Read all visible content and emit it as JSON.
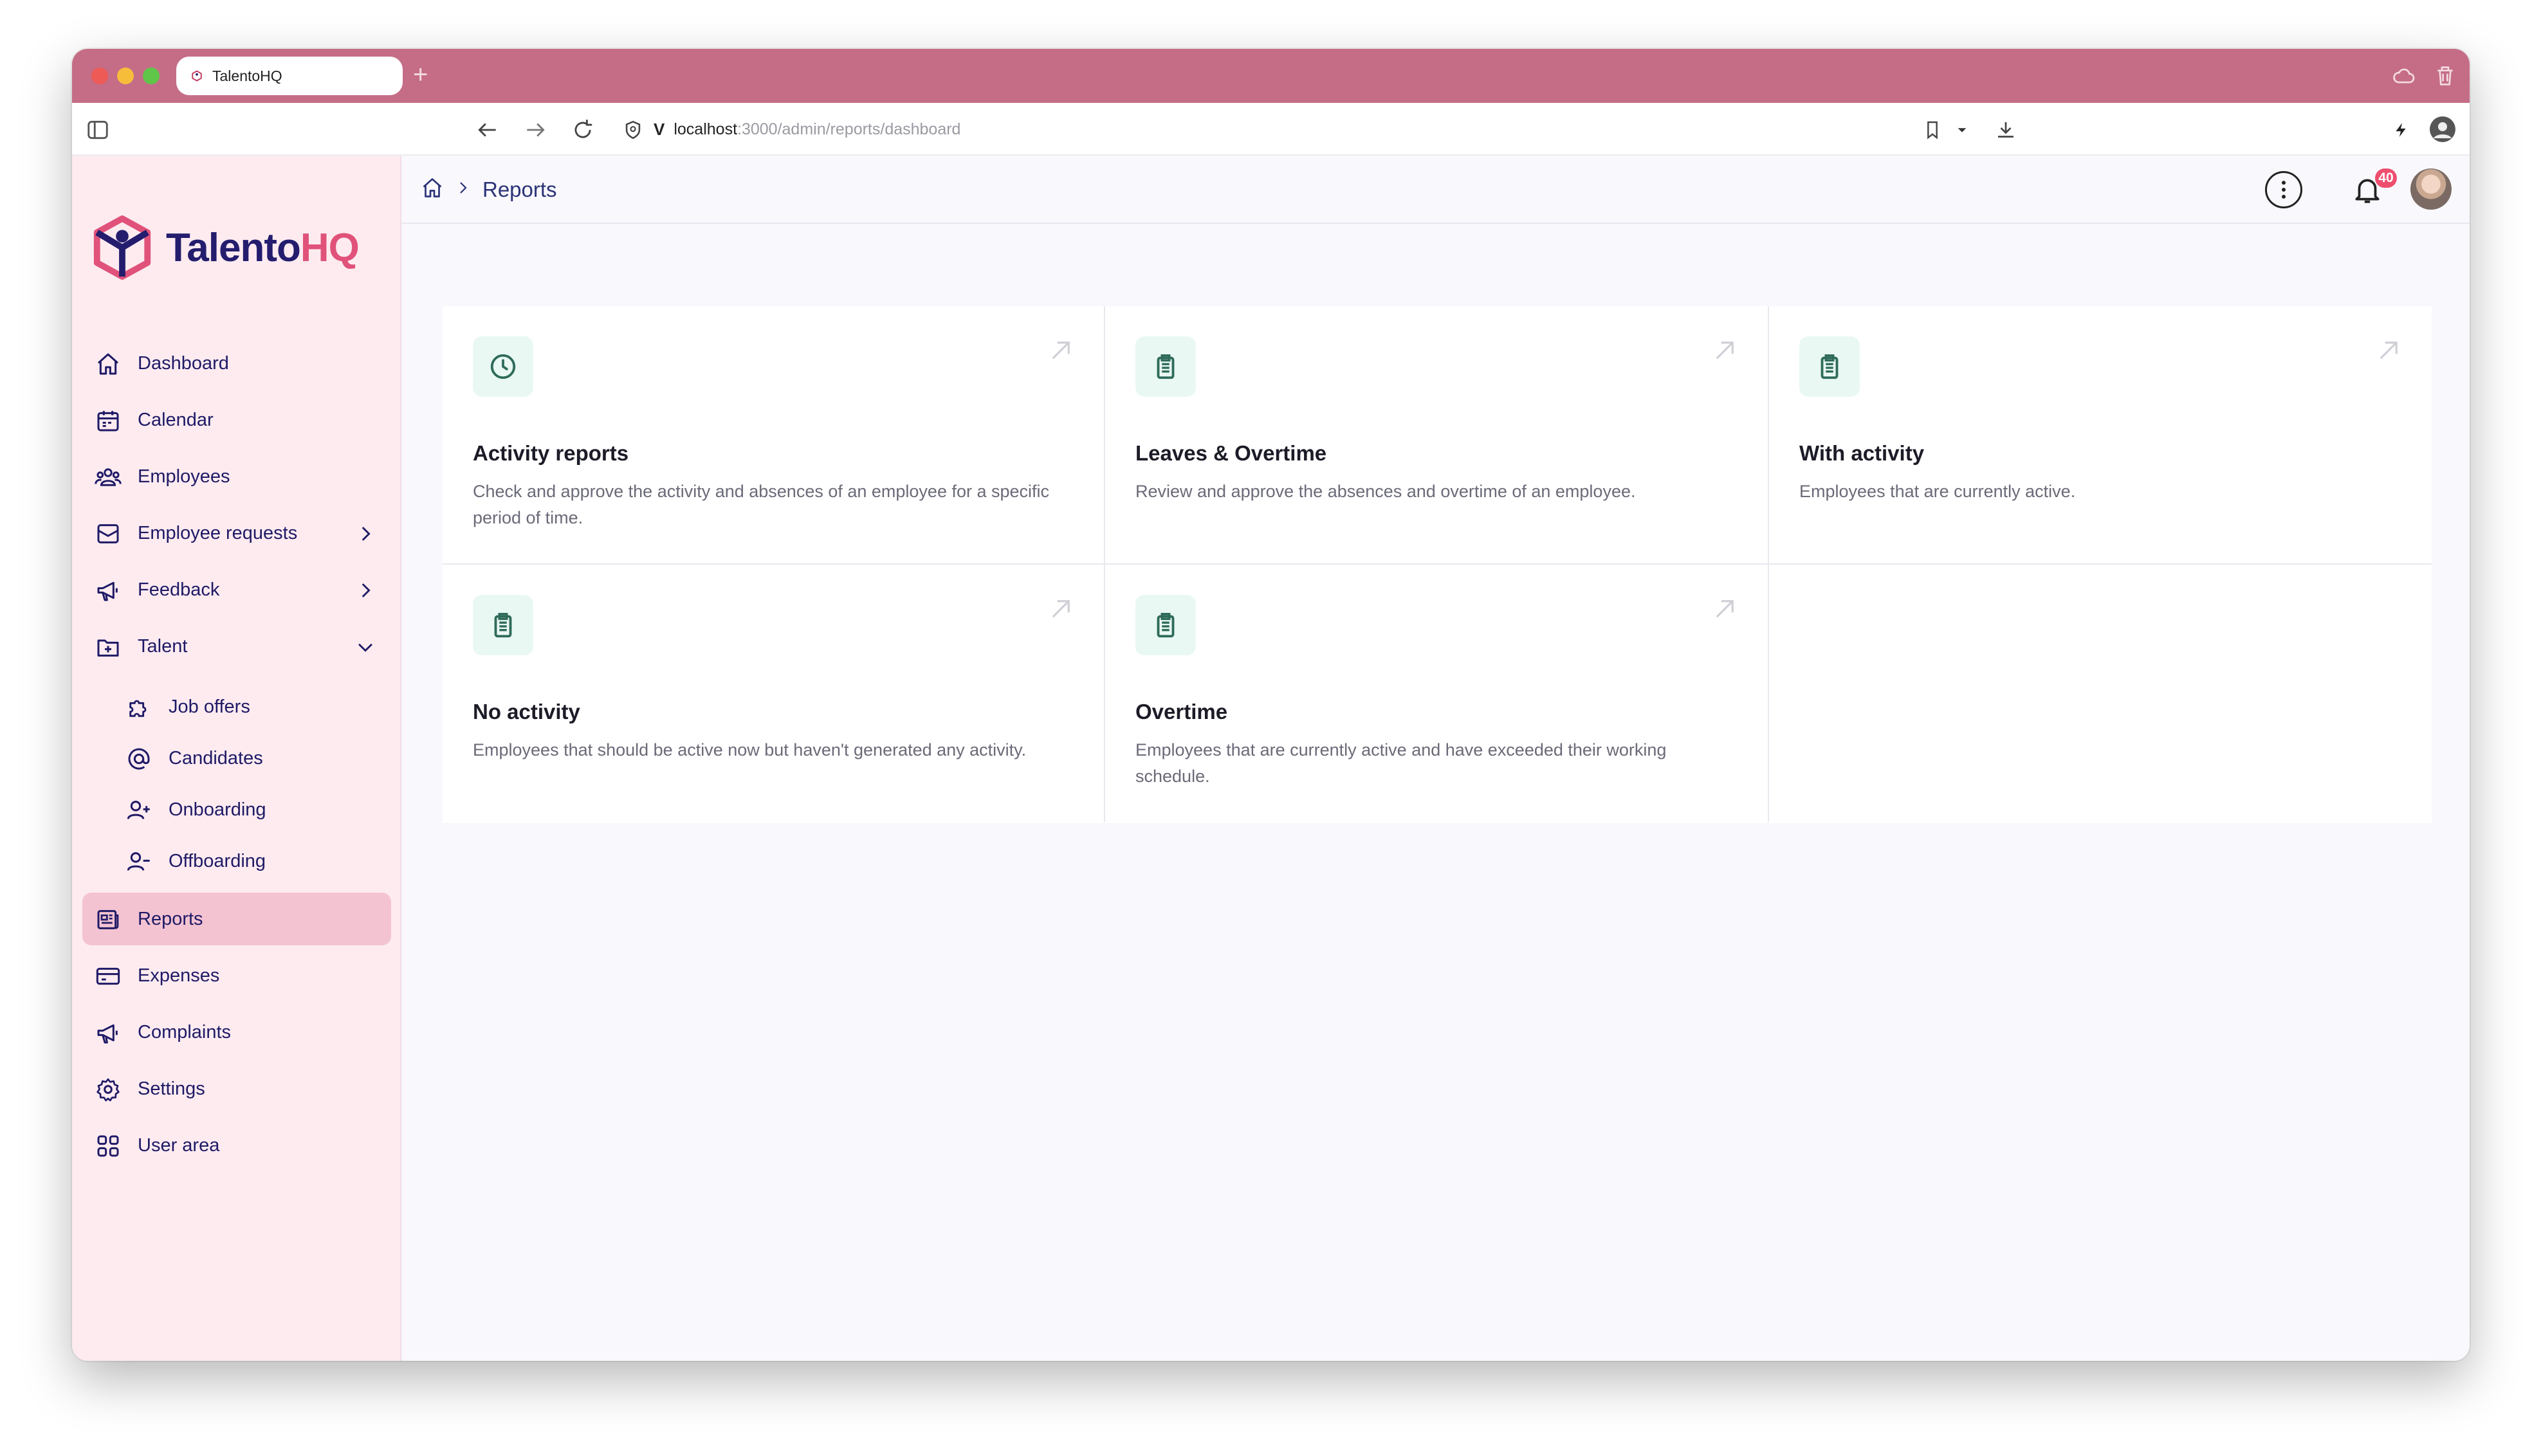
{
  "browser": {
    "tab_title": "TalentoHQ",
    "url_host": "localhost",
    "url_path": ":3000/admin/reports/dashboard"
  },
  "logo": {
    "part1": "Talento",
    "part2": "HQ"
  },
  "sidebar": {
    "items": [
      {
        "label": "Dashboard",
        "icon": "home-icon"
      },
      {
        "label": "Calendar",
        "icon": "calendar-icon"
      },
      {
        "label": "Employees",
        "icon": "users-icon"
      },
      {
        "label": "Employee requests",
        "icon": "inbox-icon"
      },
      {
        "label": "Feedback",
        "icon": "megaphone-icon"
      },
      {
        "label": "Talent",
        "icon": "folder-plus-icon"
      }
    ],
    "talent_sub": [
      {
        "label": "Job offers",
        "icon": "puzzle-icon"
      },
      {
        "label": "Candidates",
        "icon": "at-sign-icon"
      },
      {
        "label": "Onboarding",
        "icon": "user-plus-icon"
      },
      {
        "label": "Offboarding",
        "icon": "user-minus-icon"
      }
    ],
    "items_bottom": [
      {
        "label": "Reports",
        "icon": "newspaper-icon"
      },
      {
        "label": "Expenses",
        "icon": "credit-card-icon"
      },
      {
        "label": "Complaints",
        "icon": "megaphone-icon"
      },
      {
        "label": "Settings",
        "icon": "gear-icon"
      },
      {
        "label": "User area",
        "icon": "grid-icon"
      }
    ]
  },
  "header": {
    "breadcrumb": "Reports",
    "notifications_count": "40"
  },
  "cards": [
    {
      "title": "Activity reports",
      "description": "Check and approve the activity and absences of an employee for a specific period of time.",
      "icon": "clock-icon"
    },
    {
      "title": "Leaves & Overtime",
      "description": "Review and approve the absences and overtime of an employee.",
      "icon": "clipboard-icon"
    },
    {
      "title": "With activity",
      "description": "Employees that are currently active.",
      "icon": "clipboard-icon"
    },
    {
      "title": "No activity",
      "description": "Employees that should be active now but haven't generated any activity.",
      "icon": "clipboard-icon"
    },
    {
      "title": "Overtime",
      "description": "Employees that are currently active and have exceeded their working schedule.",
      "icon": "clipboard-icon"
    }
  ],
  "colors": {
    "titlebar": "#c56d86",
    "sidebar_bg": "#fdebf0",
    "active_item": "#f4c3d1",
    "nav_text": "#1f1a66",
    "brand_pink": "#e0527a",
    "icon_green": "#2f6b5a",
    "icon_bg": "#e9f8f3"
  }
}
